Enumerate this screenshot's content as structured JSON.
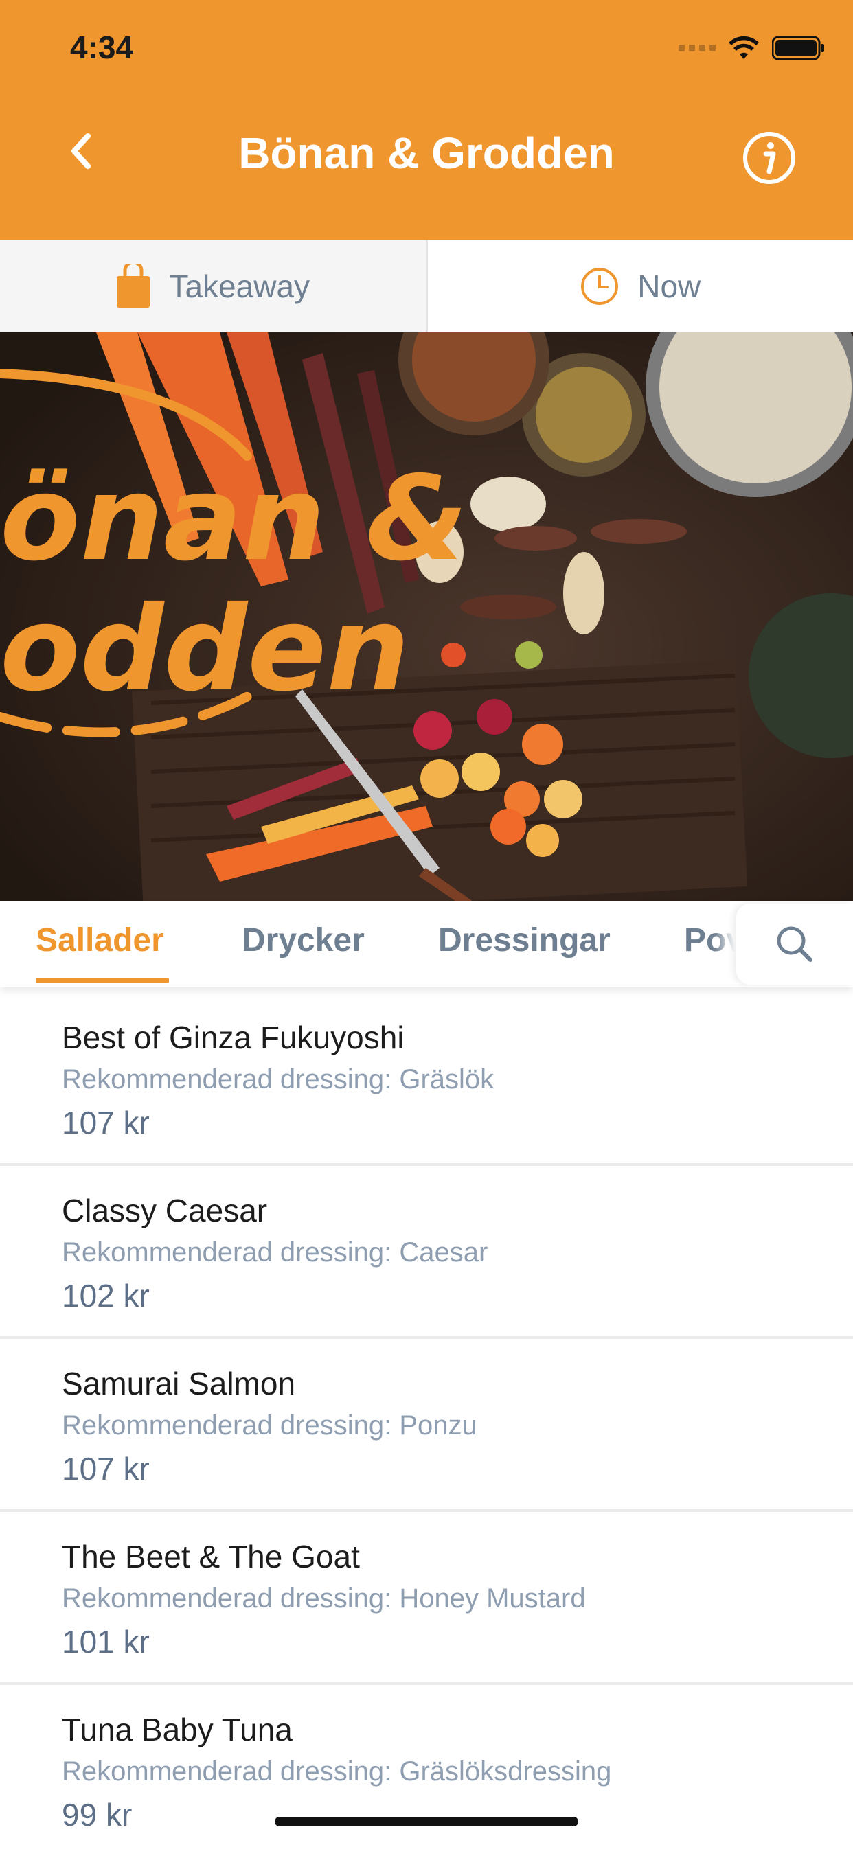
{
  "status_bar": {
    "time": "4:34"
  },
  "header": {
    "title": "Bönan & Grodden"
  },
  "mode_bar": {
    "takeaway_label": "Takeaway",
    "time_label": "Now"
  },
  "hero": {
    "logo_line1": "önan &",
    "logo_line2": "odden"
  },
  "tabs": [
    {
      "label": "Sallader",
      "active": true
    },
    {
      "label": "Drycker",
      "active": false
    },
    {
      "label": "Dressingar",
      "active": false
    },
    {
      "label": "Pov",
      "active": false
    }
  ],
  "menu_items": [
    {
      "name": "Best of Ginza Fukuyoshi",
      "description": "Rekommenderad dressing: Gräslök",
      "price": "107 kr"
    },
    {
      "name": "Classy Caesar",
      "description": "Rekommenderad dressing: Caesar",
      "price": "102 kr"
    },
    {
      "name": "Samurai Salmon",
      "description": "Rekommenderad dressing: Ponzu",
      "price": "107 kr"
    },
    {
      "name": "The Beet & The Goat",
      "description": "Rekommenderad dressing: Honey Mustard",
      "price": "101 kr"
    },
    {
      "name": "Tuna Baby Tuna",
      "description": "Rekommenderad dressing: Gräslöksdressing",
      "price": "99 kr"
    }
  ],
  "colors": {
    "accent": "#F0962E",
    "muted_text": "#6e7f91",
    "desc_text": "#8e9eb0"
  }
}
